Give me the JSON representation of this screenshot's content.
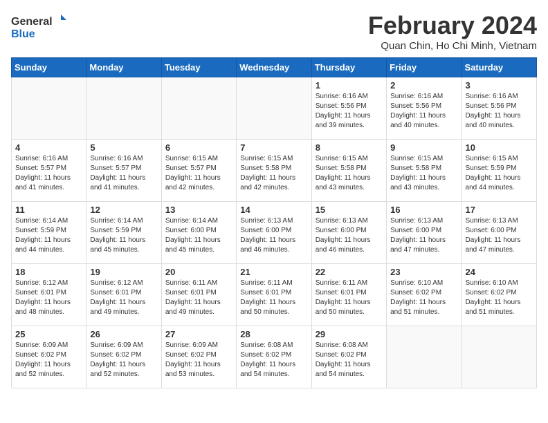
{
  "header": {
    "logo_general": "General",
    "logo_blue": "Blue",
    "month_title": "February 2024",
    "location": "Quan Chin, Ho Chi Minh, Vietnam"
  },
  "weekdays": [
    "Sunday",
    "Monday",
    "Tuesday",
    "Wednesday",
    "Thursday",
    "Friday",
    "Saturday"
  ],
  "weeks": [
    [
      {
        "day": "",
        "info": ""
      },
      {
        "day": "",
        "info": ""
      },
      {
        "day": "",
        "info": ""
      },
      {
        "day": "",
        "info": ""
      },
      {
        "day": "1",
        "info": "Sunrise: 6:16 AM\nSunset: 5:56 PM\nDaylight: 11 hours\nand 39 minutes."
      },
      {
        "day": "2",
        "info": "Sunrise: 6:16 AM\nSunset: 5:56 PM\nDaylight: 11 hours\nand 40 minutes."
      },
      {
        "day": "3",
        "info": "Sunrise: 6:16 AM\nSunset: 5:56 PM\nDaylight: 11 hours\nand 40 minutes."
      }
    ],
    [
      {
        "day": "4",
        "info": "Sunrise: 6:16 AM\nSunset: 5:57 PM\nDaylight: 11 hours\nand 41 minutes."
      },
      {
        "day": "5",
        "info": "Sunrise: 6:16 AM\nSunset: 5:57 PM\nDaylight: 11 hours\nand 41 minutes."
      },
      {
        "day": "6",
        "info": "Sunrise: 6:15 AM\nSunset: 5:57 PM\nDaylight: 11 hours\nand 42 minutes."
      },
      {
        "day": "7",
        "info": "Sunrise: 6:15 AM\nSunset: 5:58 PM\nDaylight: 11 hours\nand 42 minutes."
      },
      {
        "day": "8",
        "info": "Sunrise: 6:15 AM\nSunset: 5:58 PM\nDaylight: 11 hours\nand 43 minutes."
      },
      {
        "day": "9",
        "info": "Sunrise: 6:15 AM\nSunset: 5:58 PM\nDaylight: 11 hours\nand 43 minutes."
      },
      {
        "day": "10",
        "info": "Sunrise: 6:15 AM\nSunset: 5:59 PM\nDaylight: 11 hours\nand 44 minutes."
      }
    ],
    [
      {
        "day": "11",
        "info": "Sunrise: 6:14 AM\nSunset: 5:59 PM\nDaylight: 11 hours\nand 44 minutes."
      },
      {
        "day": "12",
        "info": "Sunrise: 6:14 AM\nSunset: 5:59 PM\nDaylight: 11 hours\nand 45 minutes."
      },
      {
        "day": "13",
        "info": "Sunrise: 6:14 AM\nSunset: 6:00 PM\nDaylight: 11 hours\nand 45 minutes."
      },
      {
        "day": "14",
        "info": "Sunrise: 6:13 AM\nSunset: 6:00 PM\nDaylight: 11 hours\nand 46 minutes."
      },
      {
        "day": "15",
        "info": "Sunrise: 6:13 AM\nSunset: 6:00 PM\nDaylight: 11 hours\nand 46 minutes."
      },
      {
        "day": "16",
        "info": "Sunrise: 6:13 AM\nSunset: 6:00 PM\nDaylight: 11 hours\nand 47 minutes."
      },
      {
        "day": "17",
        "info": "Sunrise: 6:13 AM\nSunset: 6:00 PM\nDaylight: 11 hours\nand 47 minutes."
      }
    ],
    [
      {
        "day": "18",
        "info": "Sunrise: 6:12 AM\nSunset: 6:01 PM\nDaylight: 11 hours\nand 48 minutes."
      },
      {
        "day": "19",
        "info": "Sunrise: 6:12 AM\nSunset: 6:01 PM\nDaylight: 11 hours\nand 49 minutes."
      },
      {
        "day": "20",
        "info": "Sunrise: 6:11 AM\nSunset: 6:01 PM\nDaylight: 11 hours\nand 49 minutes."
      },
      {
        "day": "21",
        "info": "Sunrise: 6:11 AM\nSunset: 6:01 PM\nDaylight: 11 hours\nand 50 minutes."
      },
      {
        "day": "22",
        "info": "Sunrise: 6:11 AM\nSunset: 6:01 PM\nDaylight: 11 hours\nand 50 minutes."
      },
      {
        "day": "23",
        "info": "Sunrise: 6:10 AM\nSunset: 6:02 PM\nDaylight: 11 hours\nand 51 minutes."
      },
      {
        "day": "24",
        "info": "Sunrise: 6:10 AM\nSunset: 6:02 PM\nDaylight: 11 hours\nand 51 minutes."
      }
    ],
    [
      {
        "day": "25",
        "info": "Sunrise: 6:09 AM\nSunset: 6:02 PM\nDaylight: 11 hours\nand 52 minutes."
      },
      {
        "day": "26",
        "info": "Sunrise: 6:09 AM\nSunset: 6:02 PM\nDaylight: 11 hours\nand 52 minutes."
      },
      {
        "day": "27",
        "info": "Sunrise: 6:09 AM\nSunset: 6:02 PM\nDaylight: 11 hours\nand 53 minutes."
      },
      {
        "day": "28",
        "info": "Sunrise: 6:08 AM\nSunset: 6:02 PM\nDaylight: 11 hours\nand 54 minutes."
      },
      {
        "day": "29",
        "info": "Sunrise: 6:08 AM\nSunset: 6:02 PM\nDaylight: 11 hours\nand 54 minutes."
      },
      {
        "day": "",
        "info": ""
      },
      {
        "day": "",
        "info": ""
      }
    ]
  ]
}
